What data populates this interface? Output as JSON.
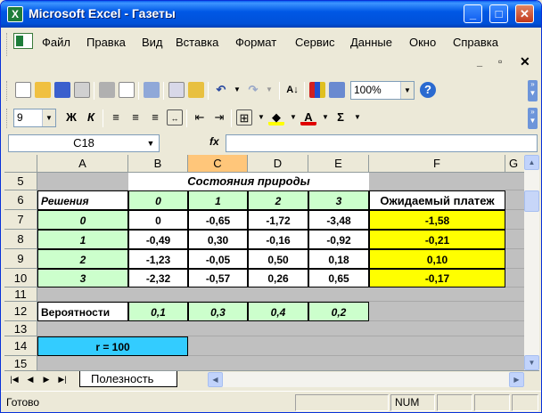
{
  "window": {
    "title": "Microsoft Excel - Газеты",
    "app_icon_glyph": "X"
  },
  "window_controls": {
    "minimize": "_",
    "maximize": "□",
    "close": "✕"
  },
  "menu": [
    {
      "label": "Файл"
    },
    {
      "label": "Правка"
    },
    {
      "label": "Вид"
    },
    {
      "label": "Вставка"
    },
    {
      "label": "Формат"
    },
    {
      "label": "Сервис"
    },
    {
      "label": "Данные"
    },
    {
      "label": "Окно"
    },
    {
      "label": "Справка"
    }
  ],
  "doc_controls": {
    "minimize": "_",
    "restore": "▫",
    "close": "✕"
  },
  "toolbar_standard": {
    "zoom": "100%"
  },
  "toolbar_format": {
    "font_size": "9",
    "bold": "Ж",
    "italic": "К",
    "sum": "Σ",
    "font_color_glyph": "A"
  },
  "formula_bar": {
    "name_box": "C18",
    "fx": "fx",
    "value": ""
  },
  "columns": [
    "A",
    "B",
    "C",
    "D",
    "E",
    "F",
    "G"
  ],
  "selected_column": "C",
  "rows": [
    "5",
    "6",
    "7",
    "8",
    "9",
    "10",
    "11",
    "12",
    "13",
    "14",
    "15"
  ],
  "sheet": {
    "states_header": "Состояния природы",
    "decisions_header": "Решения",
    "state_labels": [
      "0",
      "1",
      "2",
      "3"
    ],
    "expected_header": "Ожидаемый платеж",
    "decisions": [
      {
        "label": "0",
        "values": [
          "0",
          "-0,65",
          "-1,72",
          "-3,48"
        ],
        "expected": "-1,58"
      },
      {
        "label": "1",
        "values": [
          "-0,49",
          "0,30",
          "-0,16",
          "-0,92"
        ],
        "expected": "-0,21"
      },
      {
        "label": "2",
        "values": [
          "-1,23",
          "-0,05",
          "0,50",
          "0,18"
        ],
        "expected": "0,10"
      },
      {
        "label": "3",
        "values": [
          "-2,32",
          "-0,57",
          "0,26",
          "0,65"
        ],
        "expected": "-0,17"
      }
    ],
    "probabilities_label": "Вероятности",
    "probabilities": [
      "0,1",
      "0,3",
      "0,4",
      "0,2"
    ],
    "r_label": "r = 100"
  },
  "sheet_tabs": {
    "active": "Полезность"
  },
  "status": {
    "text": "Готово",
    "num": "NUM"
  },
  "colors": {
    "green_cell": "#ccffcc",
    "yellow_cell": "#ffff00",
    "cyan_cell": "#33ccff",
    "sheet_gray": "#c0c0c0"
  }
}
